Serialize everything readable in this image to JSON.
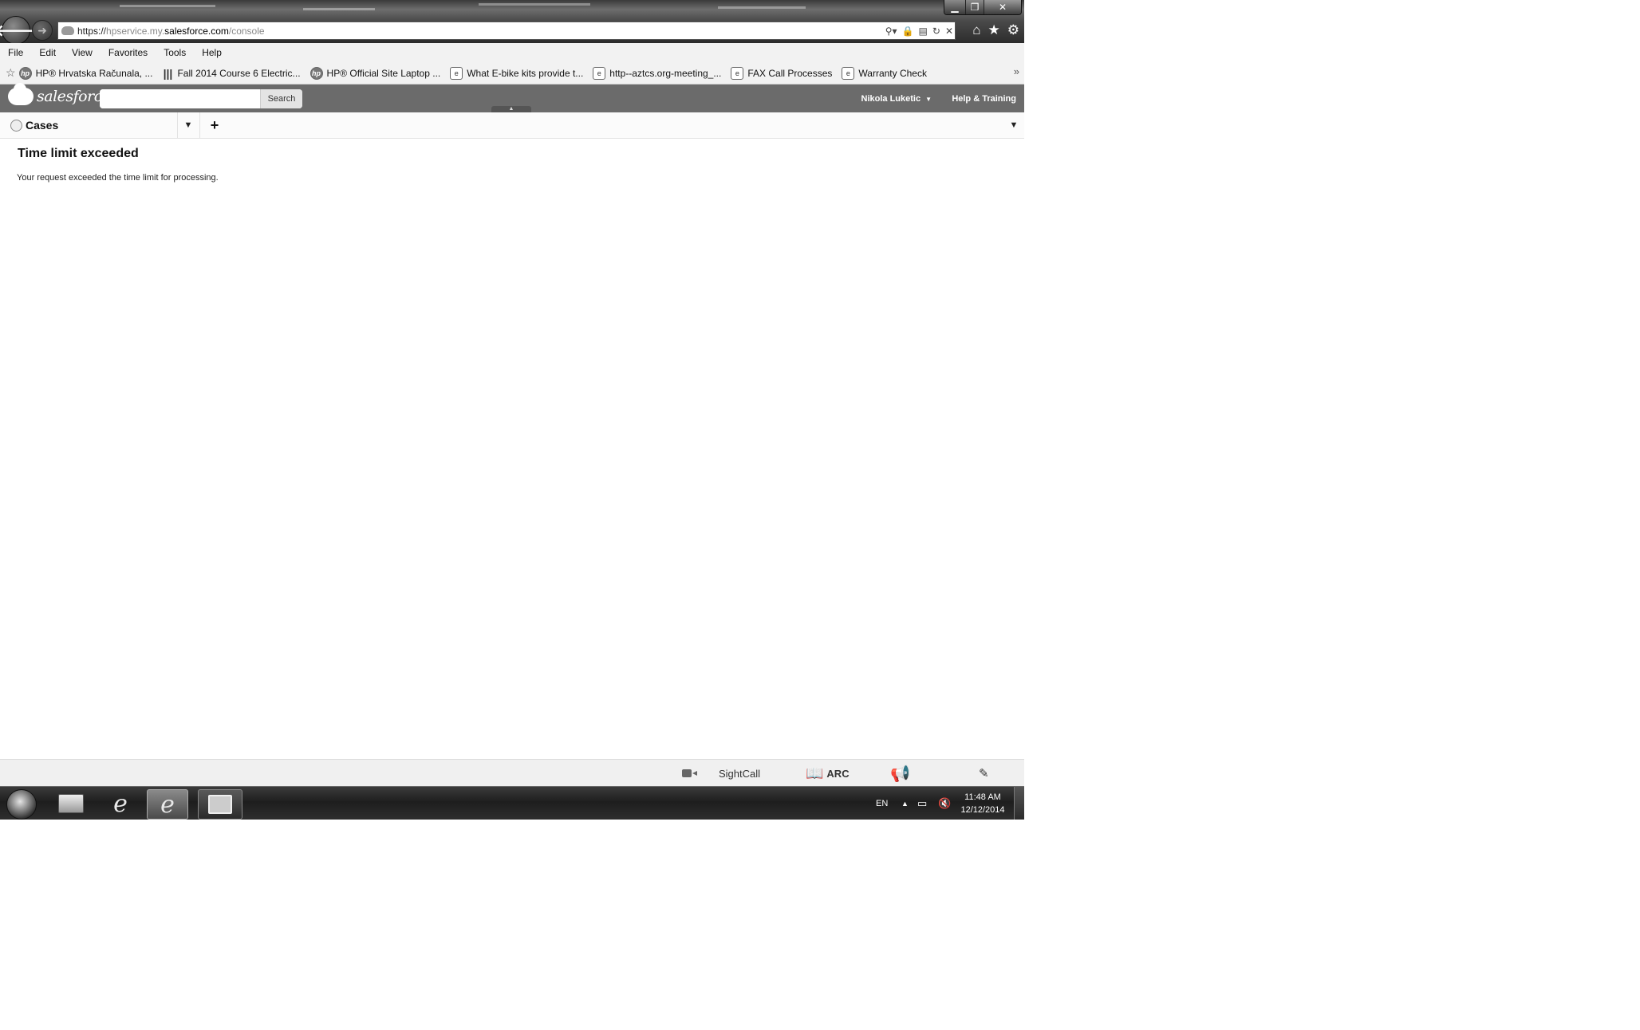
{
  "browser": {
    "window_controls": {
      "minimize": "▁",
      "restore": "❐",
      "close": "✕"
    },
    "url": {
      "proto": "https://",
      "sub": "hpservice.my.",
      "host": "salesforce.com",
      "path": "/console"
    },
    "menu": [
      "File",
      "Edit",
      "View",
      "Favorites",
      "Tools",
      "Help"
    ],
    "favorites": [
      {
        "label": "HP® Hrvatska  Računala, ...",
        "icon": "hp-icon"
      },
      {
        "label": "Fall 2014 Course 6 Electric...",
        "icon": "mit-icon"
      },
      {
        "label": "HP® Official Site  Laptop ...",
        "icon": "hp-icon"
      },
      {
        "label": "What E-bike kits provide t...",
        "icon": "ie-page-icon"
      },
      {
        "label": "http--aztcs.org-meeting_...",
        "icon": "ie-page-icon"
      },
      {
        "label": "FAX Call Processes",
        "icon": "ie-page-icon"
      },
      {
        "label": "Warranty Check",
        "icon": "ie-page-icon"
      }
    ]
  },
  "sf": {
    "logo_text": "salesforce",
    "search_placeholder": "",
    "search_button": "Search",
    "user_name": "Nikola Luketic",
    "help_link": "Help & Training",
    "tab_label": "Cases"
  },
  "page": {
    "error_title": "Time limit exceeded",
    "error_message": "Your request exceeded the time limit for processing."
  },
  "footer": {
    "sightcall": "SightCall",
    "arc": "ARC"
  },
  "taskbar": {
    "lang": "EN",
    "time": "11:48 AM",
    "date": "12/12/2014"
  }
}
